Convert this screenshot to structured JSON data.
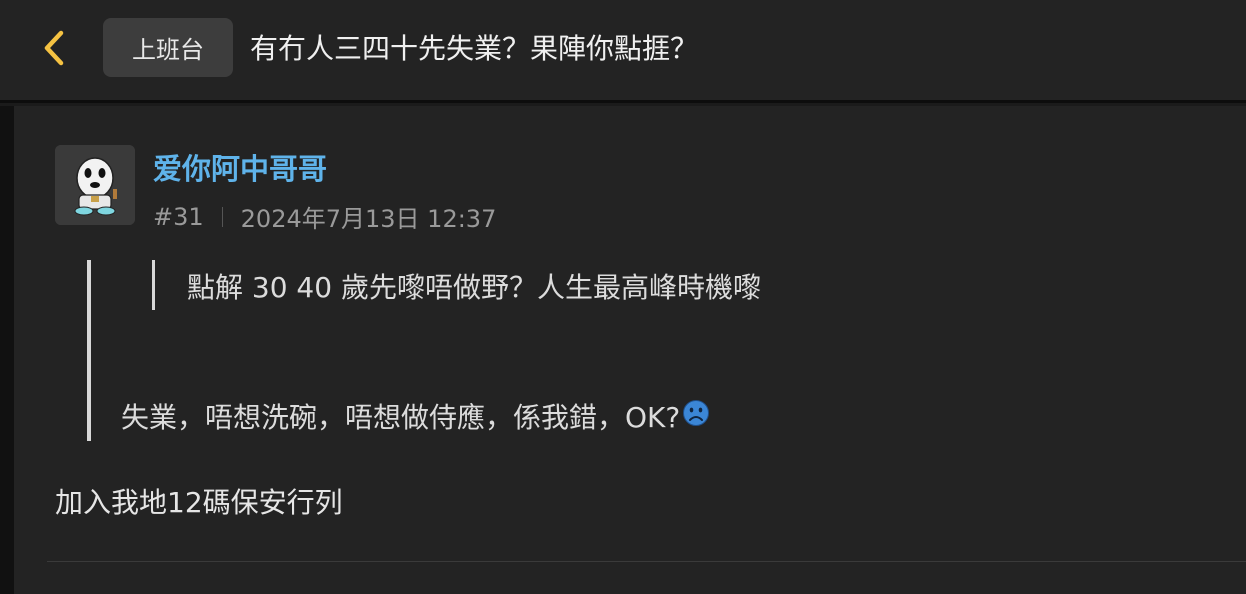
{
  "header": {
    "back_icon": "chevron-left-icon",
    "channel": "上班台",
    "title": "有冇人三四十先失業？果陣你點捱？",
    "accent": "#f5c242"
  },
  "post": {
    "username": "爱你阿中哥哥",
    "username_color": "#5fb3ea",
    "floor": "#31",
    "timestamp": "2024年7月13日 12:37",
    "quote": {
      "nested_text": "點解 30 40 歲先嚟唔做野？人生最高峰時機嚟",
      "reply_text": "失業，唔想洗碗，唔想做侍應，係我錯，OK?",
      "reply_emoji": "sad-face-icon"
    },
    "body": "加入我地12碼保安行列"
  }
}
